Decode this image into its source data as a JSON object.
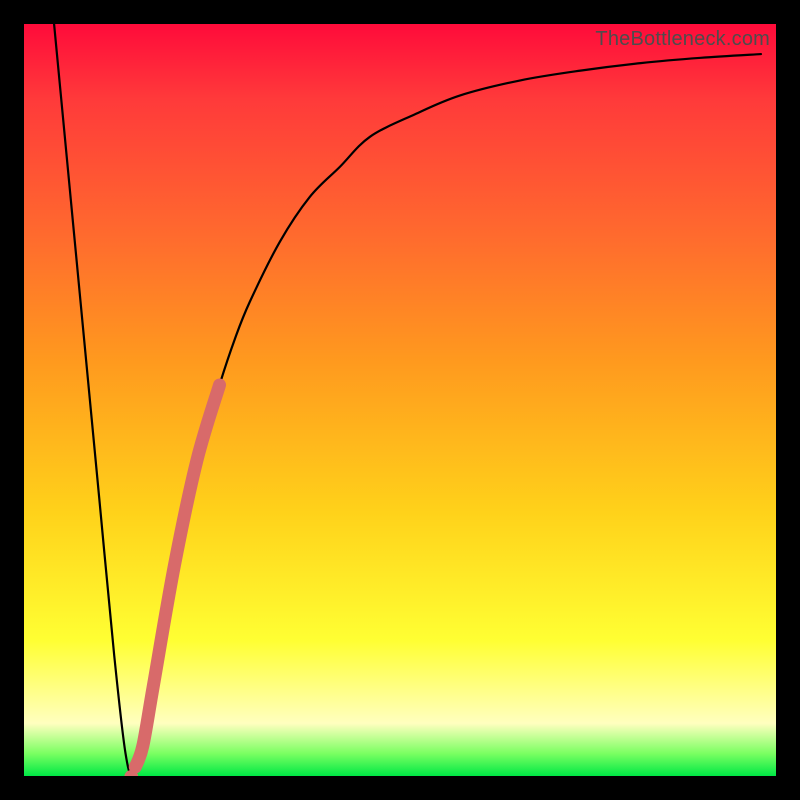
{
  "watermark": "TheBottleneck.com",
  "chart_data": {
    "type": "line",
    "title": "",
    "xlabel": "",
    "ylabel": "",
    "xlim": [
      0,
      100
    ],
    "ylim": [
      0,
      100
    ],
    "series": [
      {
        "name": "bottleneck-curve",
        "x": [
          4,
          6,
          8,
          10,
          12,
          13.5,
          14.5,
          16,
          18,
          20,
          22,
          24,
          26,
          28,
          30,
          34,
          38,
          42,
          46,
          52,
          58,
          66,
          74,
          82,
          90,
          98
        ],
        "y": [
          100,
          79,
          58,
          37,
          16,
          3,
          0.5,
          6,
          17,
          28,
          37,
          45,
          52,
          58,
          63,
          71,
          77,
          81,
          85,
          88,
          90.5,
          92.5,
          93.8,
          94.8,
          95.5,
          96
        ]
      }
    ],
    "highlight_segment": {
      "name": "pink-overlay",
      "x": [
        14.8,
        15.8,
        17.2,
        20,
        23,
        26
      ],
      "y": [
        1.2,
        4,
        12,
        28,
        42,
        52
      ]
    },
    "colors": {
      "curve": "#000000",
      "highlight": "#d86a6a",
      "gradient_top": "#ff0b3a",
      "gradient_bottom": "#00e845"
    }
  }
}
